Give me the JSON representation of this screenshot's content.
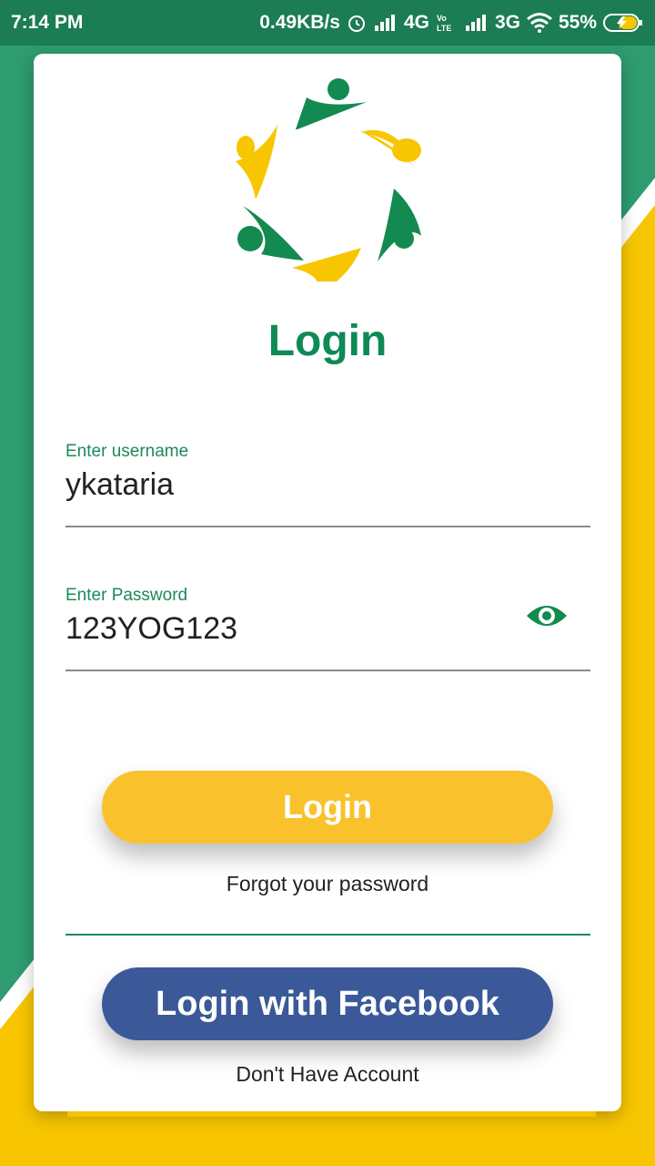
{
  "status_bar": {
    "time": "7:14 PM",
    "net_speed": "0.49KB/s",
    "network1": "4G",
    "network2": "3G",
    "battery": "55%"
  },
  "login": {
    "title": "Login",
    "username_label": "Enter username",
    "username_value": "ykataria",
    "password_label": "Enter Password",
    "password_value": "123YOG123",
    "login_button": "Login",
    "forgot_link": "Forgot your password",
    "facebook_button": "Login with Facebook",
    "signup_link": "Don't Have Account"
  },
  "colors": {
    "brand_green": "#0d8a55",
    "brand_yellow": "#f9c22c",
    "facebook_blue": "#3b5998"
  }
}
